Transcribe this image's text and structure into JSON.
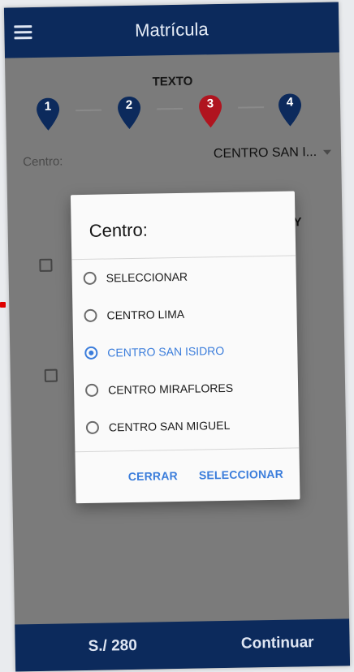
{
  "appbar": {
    "title": "Matrícula",
    "menu_icon": "hamburger-menu-icon"
  },
  "steps": {
    "heading": "TEXTO",
    "items": [
      {
        "label": "1",
        "color": "#0c2a5c"
      },
      {
        "label": "2",
        "color": "#0c2a5c"
      },
      {
        "label": "3",
        "color": "#b0141f"
      },
      {
        "label": "4",
        "color": "#0c2a5c"
      }
    ]
  },
  "form": {
    "centro_label": "Centro:",
    "centro_value": "CENTRO SAN I...",
    "fragment_text": "RY"
  },
  "dialog": {
    "title": "Centro:",
    "options": [
      {
        "label": "SELECCIONAR",
        "selected": false
      },
      {
        "label": "CENTRO LIMA",
        "selected": false
      },
      {
        "label": "CENTRO SAN ISIDRO",
        "selected": true
      },
      {
        "label": "CENTRO MIRAFLORES",
        "selected": false
      },
      {
        "label": "CENTRO SAN MIGUEL",
        "selected": false
      }
    ],
    "cancel_label": "CERRAR",
    "confirm_label": "SELECCIONAR"
  },
  "footer": {
    "price": "S./ 280",
    "continue_label": "Continuar"
  },
  "colors": {
    "primary": "#0c2a5c",
    "accent": "#3b7ddb",
    "active_step": "#b0141f",
    "overlay": "#7b7b7b"
  }
}
